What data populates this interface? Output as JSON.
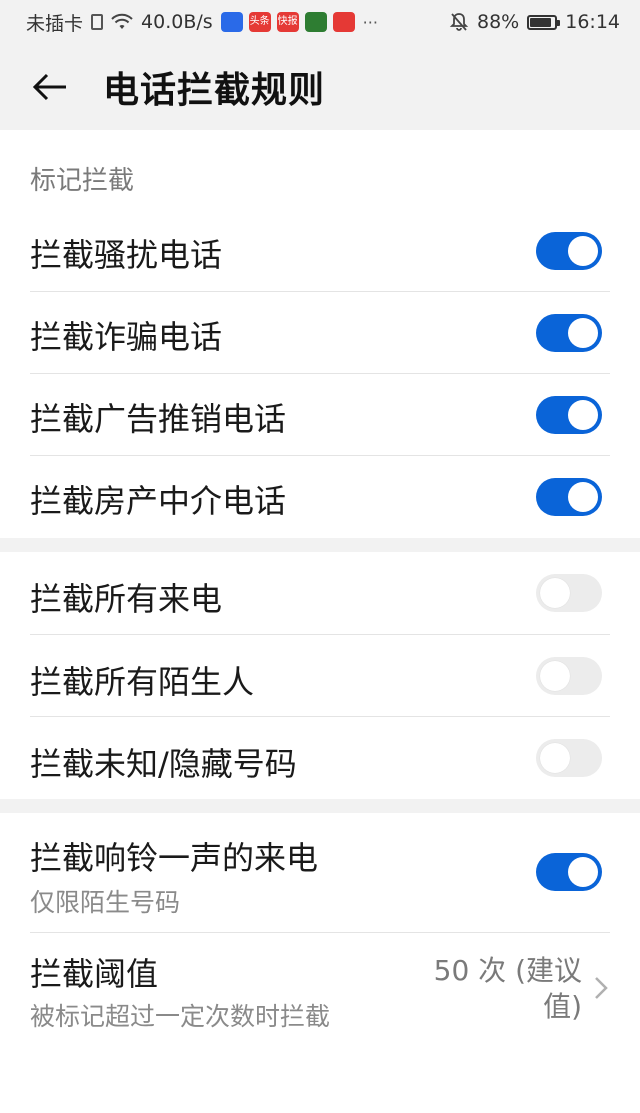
{
  "status_bar": {
    "carrier": "未插卡",
    "speed": "40.0B/s",
    "apps": [
      {
        "name": "baidu-icon",
        "text": "",
        "color": "#2a6ae8"
      },
      {
        "name": "toutiao-icon",
        "text": "头条",
        "color": "#e53935"
      },
      {
        "name": "kuaibao-icon",
        "text": "快报",
        "color": "#e53935"
      },
      {
        "name": "camera-app-icon",
        "text": "",
        "color": "#2e7d32"
      },
      {
        "name": "red-app-icon",
        "text": "",
        "color": "#e53935"
      }
    ],
    "more": "···",
    "battery_percent": "88%",
    "battery_level": 0.88,
    "time": "16:14"
  },
  "header": {
    "title": "电话拦截规则"
  },
  "sections": {
    "mark_block": {
      "header": "标记拦截",
      "items": [
        {
          "label": "拦截骚扰电话",
          "on": true
        },
        {
          "label": "拦截诈骗电话",
          "on": true
        },
        {
          "label": "拦截广告推销电话",
          "on": true
        },
        {
          "label": "拦截房产中介电话",
          "on": true
        }
      ]
    },
    "general_block": {
      "items": [
        {
          "label": "拦截所有来电",
          "on": false
        },
        {
          "label": "拦截所有陌生人",
          "on": false
        },
        {
          "label": "拦截未知/隐藏号码",
          "on": false
        }
      ]
    },
    "other_block": {
      "ring_once": {
        "label": "拦截响铃一声的来电",
        "sublabel": "仅限陌生号码",
        "on": true
      },
      "threshold": {
        "label": "拦截阈值",
        "sublabel": "被标记超过一定次数时拦截",
        "value_line1": "50 次 (建议",
        "value_line2": "值)"
      }
    }
  },
  "colors": {
    "accent": "#0a64d8",
    "toggle_off": "#ececec",
    "background_band": "#f2f2f2"
  }
}
